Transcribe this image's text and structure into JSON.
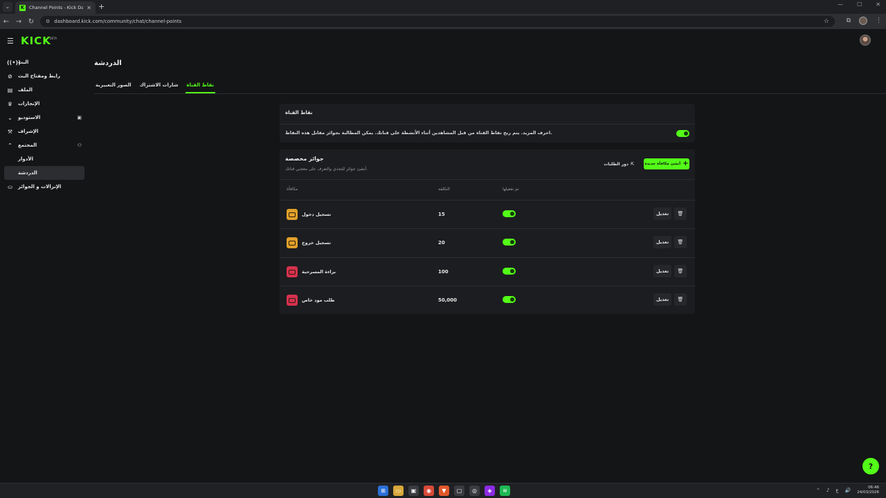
{
  "browser": {
    "tab_title": "Channel Points - Kick Dashbo...",
    "favicon_letter": "K",
    "url": "dashboard.kick.com/community/chat/channel-points"
  },
  "header": {
    "logo": "KICK",
    "logo_badge": "BETA"
  },
  "sidebar": {
    "items": [
      {
        "label": "البث",
        "icon": "broadcast-icon"
      },
      {
        "label": "رابط ومفتاح البث",
        "icon": "link-icon"
      },
      {
        "label": "الملف",
        "icon": "file-icon"
      },
      {
        "label": "الإنجازات",
        "icon": "trophy-icon"
      },
      {
        "label": "الاستوديو",
        "icon": "studio-icon"
      },
      {
        "label": "الإشراف",
        "icon": "moderation-icon"
      },
      {
        "label": "المجتمع",
        "icon": "community-icon"
      },
      {
        "label": "الأدوار"
      },
      {
        "label": "الدردشة"
      },
      {
        "label": "الإنزالات و الجوائز",
        "icon": "drops-icon"
      }
    ]
  },
  "page": {
    "title": "الدردشة",
    "tabs": [
      "نقاط القناة",
      "شارات الاشتراك",
      "الصور التعبيرية"
    ]
  },
  "channel_points": {
    "title": "نقاط القناة",
    "description": "احرف المزيد. يتم ربح نقاط القناة من قبل المشاهدين أثناء الأنشطة على قناتك. يمكن المطالبة بجوائز مقابل هذه النقاط.",
    "enabled": true
  },
  "custom_rewards": {
    "title": "جوائز مخصصة",
    "subtitle": "أنشئ جوائز للتحدي والتعرف على معجبي قناتك.",
    "new_button": "أنشئ مكافأة جديدة",
    "manage_button": "دور الطلبات",
    "columns": {
      "reward": "مكافأة",
      "cost": "التكلفة",
      "enabled": "تم تفعيلها"
    },
    "edit_label": "تعديل",
    "rows": [
      {
        "name": "تسجيل دخول",
        "cost": "15",
        "enabled": true,
        "color": "#e0a02a"
      },
      {
        "name": "تسجيل خروج",
        "cost": "20",
        "enabled": true,
        "color": "#e0a02a"
      },
      {
        "name": "براءة المسرحية",
        "cost": "100",
        "enabled": true,
        "color": "#d6314f"
      },
      {
        "name": "طلب مود خاص",
        "cost": "50,000",
        "enabled": true,
        "color": "#d6314f"
      }
    ]
  },
  "taskbar": {
    "lang": "ع",
    "time": "06:46",
    "date": "24/03/2026"
  },
  "colors": {
    "accent": "#53fc18",
    "background": "#141517",
    "card": "#1c1d20"
  }
}
